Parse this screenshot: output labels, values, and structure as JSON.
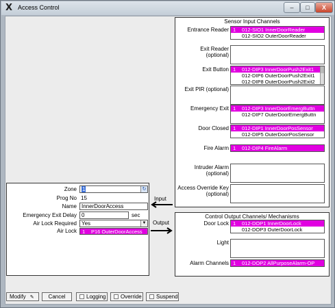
{
  "window": {
    "title": "Access Control",
    "app_icon": "X",
    "controls": {
      "minimize": "–",
      "maximize": "□",
      "close": "X"
    }
  },
  "sensor_panel": {
    "title": "Sensor Input Channels",
    "rows": [
      {
        "label": "Entrance Reader",
        "items": [
          {
            "num": "1",
            "text": "012-SIO1 InnerDoorReader",
            "selected": true
          },
          {
            "num": "",
            "text": "012-SIO2 OuterDoorReader",
            "selected": false
          }
        ]
      },
      {
        "label": "Exit Reader (optional)",
        "items": []
      },
      {
        "label": "Exit Button",
        "items": [
          {
            "num": "1",
            "text": "012-DIP3 InnerDoorPush2Exit1",
            "selected": true
          },
          {
            "num": "",
            "text": "012-DIP6 OuterDoorPush2Exit1",
            "selected": false
          },
          {
            "num": "",
            "text": "012-DIP8 OuterDoorPush2Exit2",
            "selected": false
          }
        ]
      },
      {
        "label": "Exit PIR (optional)",
        "items": []
      },
      {
        "label": "Emergency Exit",
        "items": [
          {
            "num": "1",
            "text": "012-DIP3 InnerDoorEmergButtn",
            "selected": true
          },
          {
            "num": "",
            "text": "012-DIP7 OuterDoorEmergButtn",
            "selected": false
          }
        ]
      },
      {
        "label": "Door Closed",
        "items": [
          {
            "num": "1",
            "text": "012-DIP1 InnerDoorPosSensor",
            "selected": true
          },
          {
            "num": "",
            "text": "012-DIP5 OuterDoorPosSensor",
            "selected": false
          }
        ]
      },
      {
        "label": "Fire Alarm",
        "items": [
          {
            "num": "1",
            "text": "012-DIP4 FireAlarm",
            "selected": true
          }
        ]
      },
      {
        "label": "Intruder Alarm (optional)",
        "items": []
      },
      {
        "label": "Access Override Key (optional)",
        "items": []
      }
    ]
  },
  "output_panel": {
    "title": "Control Output Channels/ Mechanisms",
    "rows": [
      {
        "label": "Door Lock",
        "items": [
          {
            "num": "1",
            "text": "012-DOP1 InnerDoorLock",
            "selected": true
          },
          {
            "num": "",
            "text": "012-DOP3 OuterDoorLock",
            "selected": false
          }
        ]
      },
      {
        "label": "Light",
        "items": []
      },
      {
        "label": "Alarm Channels",
        "items": [
          {
            "num": "1",
            "text": "012-DOP2 AllPurposeAlarm-OP",
            "selected": true
          }
        ]
      }
    ]
  },
  "zone_panel": {
    "zone_label": "Zone",
    "zone_value": "1",
    "prog_label": "Prog No",
    "prog_value": "15",
    "name_label": "Name",
    "name_value": "InnerDoorAccess",
    "delay_label": "Emergency Exit Delay",
    "delay_value": "0",
    "delay_unit": "sec",
    "airlock_req_label": "Air Lock Required",
    "airlock_req_value": "Yes",
    "airlock_label": "Air Lock",
    "airlock_item": {
      "num": "1",
      "text": "P16 OuterDoorAccess"
    }
  },
  "arrows": {
    "input": "Input",
    "output": "Output"
  },
  "buttons": {
    "modify": "Modify",
    "cancel": "Cancel",
    "logging": "Logging",
    "override": "Override",
    "suspend": "Suspend"
  }
}
